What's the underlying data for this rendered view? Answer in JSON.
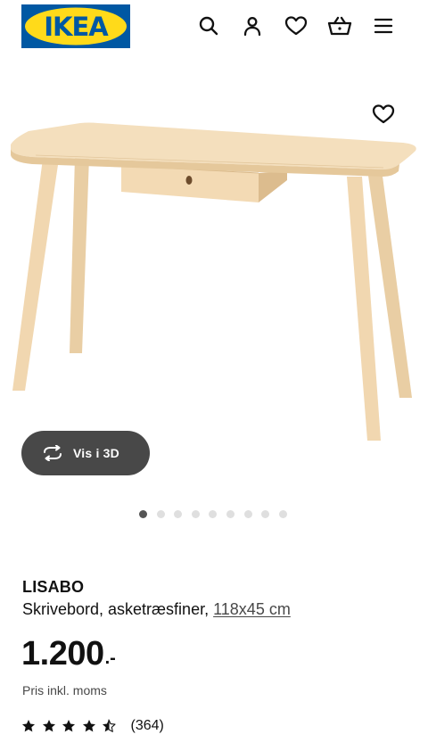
{
  "header": {
    "brand": "IKEA",
    "icons": [
      "search-icon",
      "user-icon",
      "heart-icon",
      "basket-icon",
      "menu-icon"
    ]
  },
  "gallery": {
    "view_3d_label": "Vis i 3D",
    "slide_count": 9,
    "active_slide": 1
  },
  "product": {
    "name": "LISABO",
    "description": "Skrivebord, asketræsfiner,",
    "size_link": "118x45 cm",
    "price": "1.200",
    "price_suffix": ".-",
    "vat_note": "Pris inkl. moms",
    "rating_value": 4.5,
    "rating_max": 5,
    "review_count": "(364)"
  },
  "colors": {
    "brand_blue": "#0058a3",
    "brand_yellow": "#ffda1a",
    "button_dark": "#484848",
    "dot_active": "#555555",
    "dot_inactive": "#dfdfdf",
    "wood_light": "#f3dcb8",
    "wood_shade": "#e3c59a"
  }
}
